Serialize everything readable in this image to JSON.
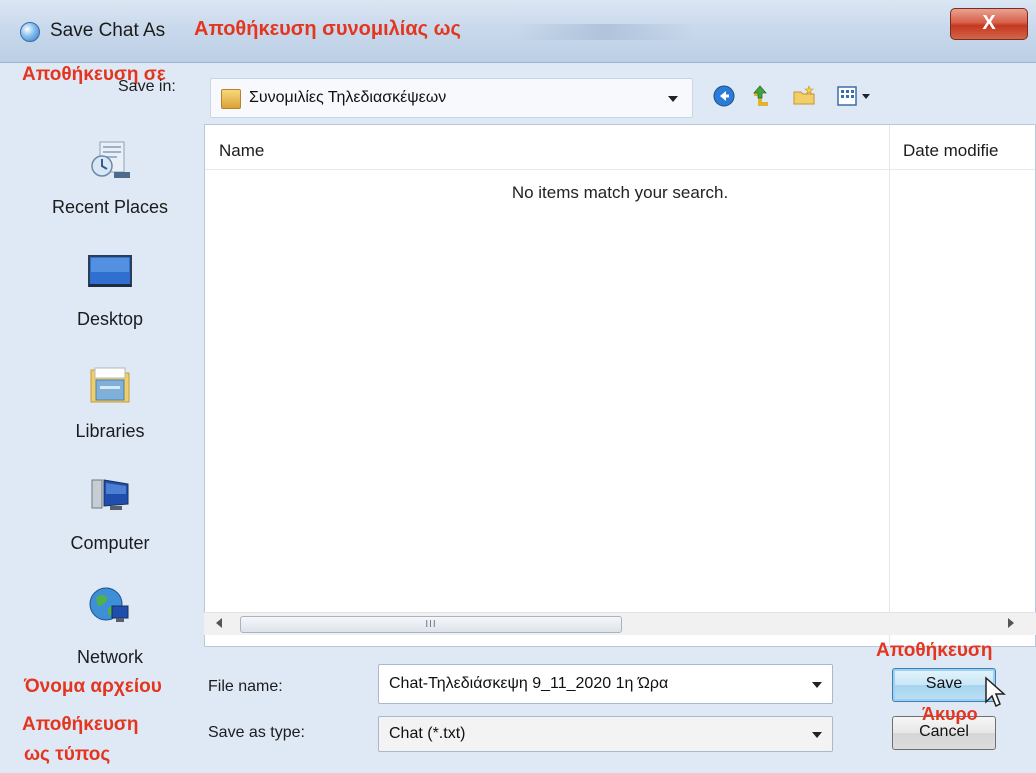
{
  "window": {
    "title": "Save Chat As",
    "title_annotation": "Αποθήκευση συνομιλίας ως",
    "close_label": "X"
  },
  "save_in": {
    "annotation": "Αποθήκευση σε",
    "label": "Save in:",
    "value": "Συνομιλίες Τηλεδιασκέψεων"
  },
  "toolbar": {
    "icons": [
      "back-icon",
      "up-folder-icon",
      "new-folder-icon",
      "view-menu-icon"
    ]
  },
  "places": [
    {
      "label": "Recent Places",
      "icon": "recent-places-icon"
    },
    {
      "label": "Desktop",
      "icon": "desktop-icon"
    },
    {
      "label": "Libraries",
      "icon": "libraries-icon"
    },
    {
      "label": "Computer",
      "icon": "computer-icon"
    },
    {
      "label": "Network",
      "icon": "network-icon"
    }
  ],
  "file_list": {
    "columns": [
      "Name",
      "Date modifie"
    ],
    "empty_message": "No items match your search.",
    "scroll_grip": "III"
  },
  "file_name": {
    "annotation": "Όνομα αρχείου",
    "label": "File name:",
    "value": "Chat-Τηλεδιάσκεψη 9_11_2020 1η Ώρα"
  },
  "save_as_type": {
    "annotation_line1": "Αποθήκευση",
    "annotation_line2": "ως τύπος",
    "label": "Save as type:",
    "value": "Chat (*.txt)"
  },
  "buttons": {
    "save_annotation": "Αποθήκευση",
    "save_label": "Save",
    "cancel_annotation": "Άκυρο",
    "cancel_label": "Cancel"
  },
  "colors": {
    "annotation": "#e4351f",
    "dialog_bg": "#dfe9f5",
    "save_button": "#bde1f5"
  }
}
